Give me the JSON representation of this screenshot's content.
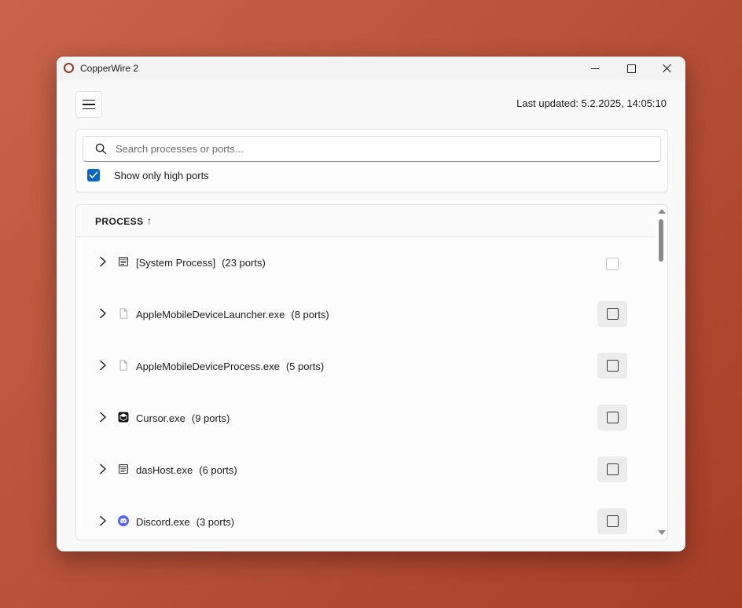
{
  "window": {
    "title": "CopperWire 2"
  },
  "header": {
    "last_updated": "Last updated: 5.2.2025, 14:05:10"
  },
  "search": {
    "placeholder": "Search processes or ports...",
    "value": ""
  },
  "filters": {
    "high_ports_label": "Show only high ports",
    "high_ports_checked": true
  },
  "list": {
    "column_header": "PROCESS",
    "sort_indicator": "↑",
    "rows": [
      {
        "name": "[System Process]",
        "ports": "(23 ports)",
        "icon": "system-window-icon"
      },
      {
        "name": "AppleMobileDeviceLauncher.exe",
        "ports": "(8 ports)",
        "icon": "blank-file-icon"
      },
      {
        "name": "AppleMobileDeviceProcess.exe",
        "ports": "(5 ports)",
        "icon": "blank-file-icon"
      },
      {
        "name": "Cursor.exe",
        "ports": "(9 ports)",
        "icon": "cursor-app-icon"
      },
      {
        "name": "dasHost.exe",
        "ports": "(6 ports)",
        "icon": "system-window-icon"
      },
      {
        "name": "Discord.exe",
        "ports": "(3 ports)",
        "icon": "discord-icon"
      }
    ]
  },
  "colors": {
    "accent": "#0a66c2",
    "discord": "#5865f2",
    "brand": "#8a3a22"
  }
}
